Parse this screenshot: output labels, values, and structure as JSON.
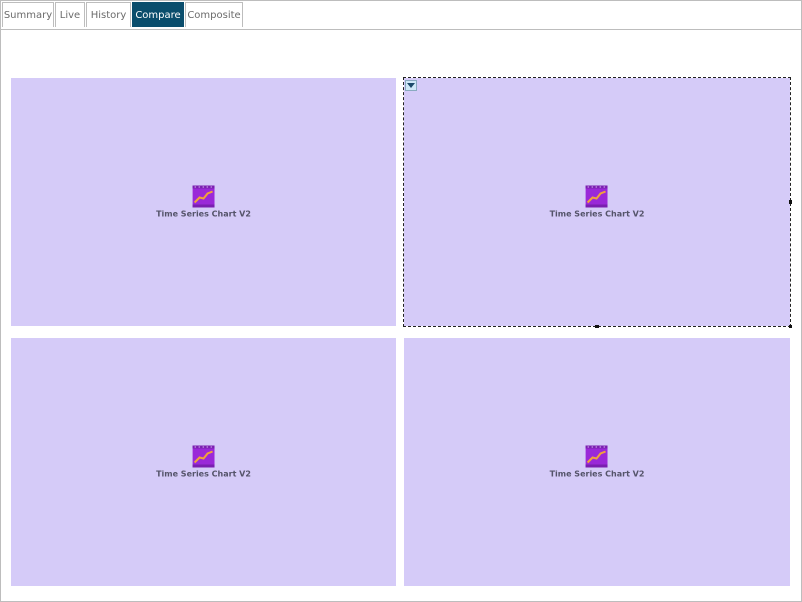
{
  "tabs": [
    {
      "label": "Summary"
    },
    {
      "label": "Live"
    },
    {
      "label": "History"
    },
    {
      "label": "Compare"
    },
    {
      "label": "Composite"
    }
  ],
  "active_tab": "Compare",
  "colors": {
    "active_tab_bg": "#0a4d6c",
    "panel_bg": "#d5cbf8",
    "icon_bg": "#9a28d8",
    "icon_line": "#f2a23a"
  },
  "panels": [
    {
      "label": "Time Series Chart V2",
      "icon": "time-series-chart-icon"
    },
    {
      "label": "Time Series Chart V2",
      "icon": "time-series-chart-icon",
      "selected": true
    },
    {
      "label": "Time Series Chart V2",
      "icon": "time-series-chart-icon"
    },
    {
      "label": "Time Series Chart V2",
      "icon": "time-series-chart-icon"
    }
  ]
}
